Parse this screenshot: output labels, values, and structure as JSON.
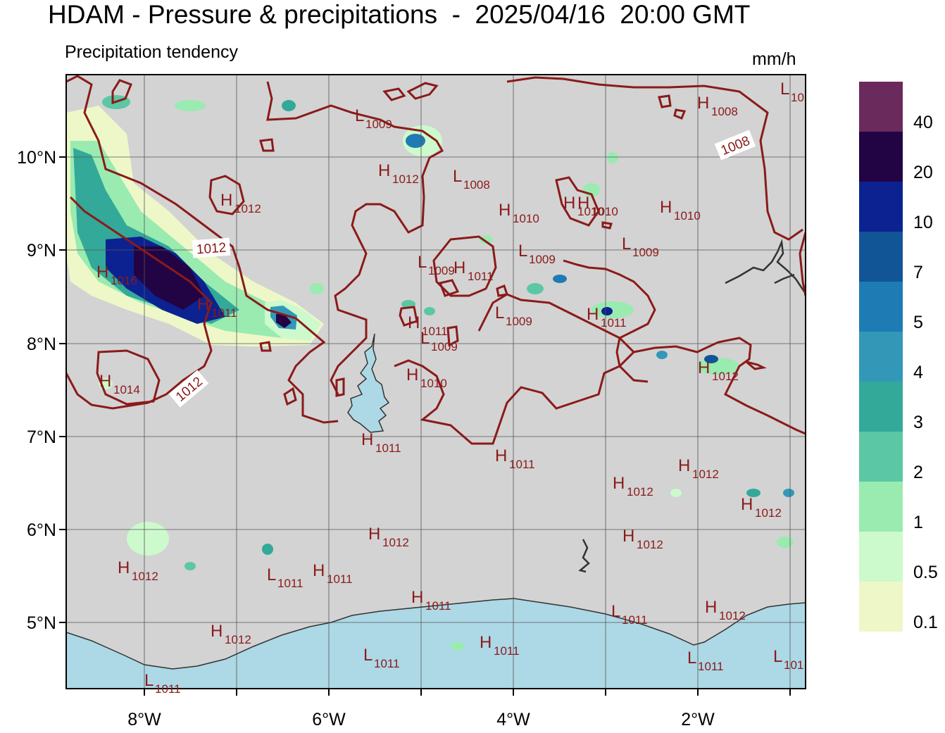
{
  "title": "HDAM - Pressure & precipitations  -  2025/04/16  20:00 GMT",
  "subtitle": "Precipitation tendency",
  "units": "mm/h",
  "colors": {
    "land": "#d3d3d3",
    "sea": "#add8e6",
    "isobar": "#8b1a1a",
    "grid": "#555555",
    "coast": "#333333"
  },
  "axes": {
    "x_ticks": [
      "8°W",
      "6°W",
      "4°W",
      "2°W"
    ],
    "y_ticks": [
      "10°N",
      "9°N",
      "8°N",
      "7°N",
      "6°N",
      "5°N"
    ]
  },
  "legend": [
    {
      "label": "0.1",
      "color": "#eef7c8"
    },
    {
      "label": "0.5",
      "color": "#ccfacc"
    },
    {
      "label": "1",
      "color": "#99ebb0"
    },
    {
      "label": "2",
      "color": "#5cc7a4"
    },
    {
      "label": "3",
      "color": "#33a999"
    },
    {
      "label": "4",
      "color": "#3398b8"
    },
    {
      "label": "5",
      "color": "#1f7bb4"
    },
    {
      "label": "7",
      "color": "#125596"
    },
    {
      "label": "10",
      "color": "#0c2290"
    },
    {
      "label": "20",
      "color": "#220445"
    },
    {
      "label": "40",
      "color": "#6b2a5c"
    }
  ],
  "pressure_centers": [
    {
      "t": "L",
      "v": "10"
    },
    {
      "t": "L",
      "v": "1009"
    },
    {
      "t": "H",
      "v": "1008"
    },
    {
      "t": "H",
      "v": "1012"
    },
    {
      "t": "L",
      "v": "1008"
    },
    {
      "t": "H",
      "v": "1012"
    },
    {
      "t": "H",
      "v": "1010"
    },
    {
      "t": "H",
      "v": "1010"
    },
    {
      "t": "H",
      "v": "1010"
    },
    {
      "t": "H",
      "v": "1010"
    },
    {
      "t": "L",
      "v": "1009"
    },
    {
      "t": "L",
      "v": "1009"
    },
    {
      "t": "L",
      "v": "1009"
    },
    {
      "t": "H",
      "v": "1011"
    },
    {
      "t": "H",
      "v": "1016"
    },
    {
      "t": "H",
      "v": "1011"
    },
    {
      "t": "H",
      "v": "1011"
    },
    {
      "t": "L",
      "v": "1009"
    },
    {
      "t": "H",
      "v": "1011"
    },
    {
      "t": "L",
      "v": "1009"
    },
    {
      "t": "H",
      "v": "1014"
    },
    {
      "t": "H",
      "v": "1010"
    },
    {
      "t": "H",
      "v": "1012"
    },
    {
      "t": "H",
      "v": "1011"
    },
    {
      "t": "H",
      "v": "1011"
    },
    {
      "t": "H",
      "v": "1012"
    },
    {
      "t": "H",
      "v": "1012"
    },
    {
      "t": "H",
      "v": "1012"
    },
    {
      "t": "H",
      "v": "1012"
    },
    {
      "t": "H",
      "v": "1012"
    },
    {
      "t": "H",
      "v": "1012"
    },
    {
      "t": "L",
      "v": "1011"
    },
    {
      "t": "H",
      "v": "1011"
    },
    {
      "t": "H",
      "v": "1011"
    },
    {
      "t": "L",
      "v": "1011"
    },
    {
      "t": "H",
      "v": "1012"
    },
    {
      "t": "H",
      "v": "1012"
    },
    {
      "t": "L",
      "v": "1011"
    },
    {
      "t": "H",
      "v": "1011"
    },
    {
      "t": "L",
      "v": "1011"
    },
    {
      "t": "L",
      "v": "101"
    },
    {
      "t": "L",
      "v": "1011"
    }
  ],
  "isobar_labels": [
    "1012",
    "1012",
    "1008"
  ]
}
